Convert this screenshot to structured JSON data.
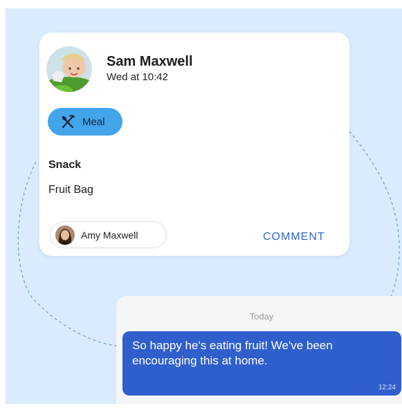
{
  "post": {
    "author": "Sam Maxwell",
    "timestamp": "Wed at 10:42",
    "category_icon": "fork-knife-icon",
    "category": "Meal",
    "section_title": "Snack",
    "item": "Fruit Bag",
    "tagged_person": "Amy Maxwell",
    "comment_label": "COMMENT"
  },
  "chat": {
    "date_label": "Today",
    "message": "So happy he's eating fruit! We've been encouraging this at home.",
    "message_time": "12:24"
  },
  "colors": {
    "background": "#d9ebfd",
    "chip": "#42a5ea",
    "bubble": "#2f5fcc",
    "comment": "#3268c8"
  }
}
